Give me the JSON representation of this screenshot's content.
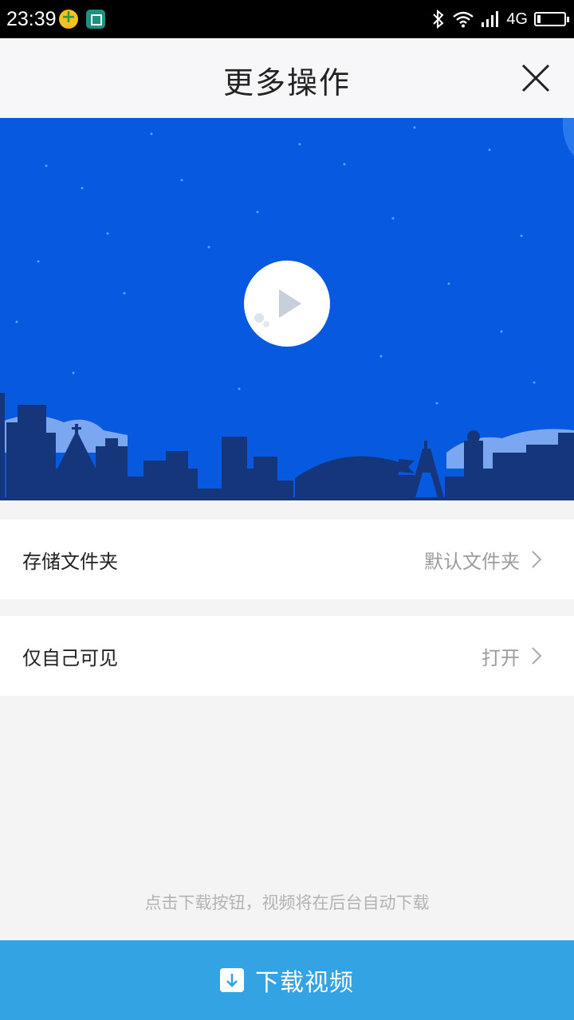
{
  "status_bar": {
    "time": "23:39",
    "network": "4G",
    "battery_level": 0.12,
    "icons": [
      "notification-plus-icon",
      "screenshot-icon",
      "bluetooth-icon",
      "wifi-icon",
      "signal-icon",
      "battery-icon"
    ]
  },
  "header": {
    "title": "更多操作",
    "close_icon": "close-icon"
  },
  "preview": {
    "play_icon": "play-icon",
    "colors": {
      "sky": "#0759e0",
      "city": "#15367a",
      "clouds": "#7aa7f0"
    }
  },
  "settings": [
    {
      "label": "存储文件夹",
      "value": "默认文件夹"
    },
    {
      "label": "仅自己可见",
      "value": "打开"
    }
  ],
  "hint": "点击下载按钮，视频将在后台自动下载",
  "download_button": {
    "label": "下载视频",
    "icon": "download-icon",
    "color": "#33a3e4"
  }
}
